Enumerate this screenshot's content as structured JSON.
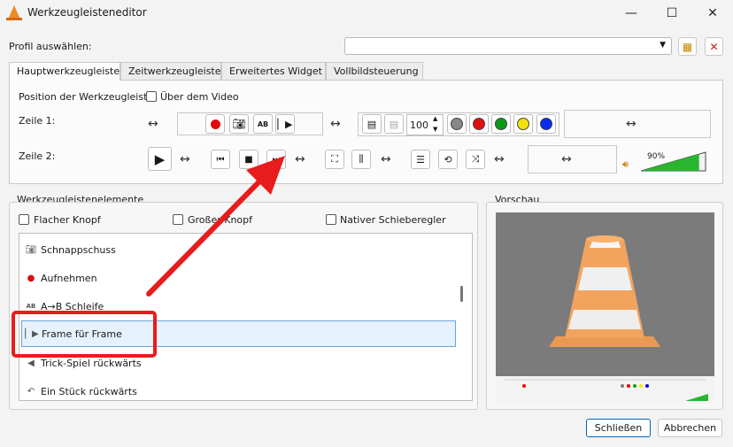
{
  "window": {
    "title": "Werkzeugleisteneditor",
    "minimize": "—",
    "maximize": "☐",
    "close": "✕"
  },
  "profile": {
    "label": "Profil auswählen:",
    "value": "",
    "arrow": "▼"
  },
  "tabs": [
    "Hauptwerkzeugleiste",
    "Zeitwerkzeugleiste",
    "Erweitertes Widget",
    "Vollbildsteuerung"
  ],
  "position": {
    "label": "Position der Werkzeugleiste:",
    "checkbox_label": "Über dem Video"
  },
  "rows": {
    "row1_label": "Zeile 1:",
    "row2_label": "Zeile 2:"
  },
  "spacer_glyph": "↔",
  "spin": {
    "value": "100",
    "up": "▲",
    "down": "▼"
  },
  "volume": {
    "percent": "90%",
    "level": 0.9
  },
  "elements": {
    "group_title": "Werkzeugleistenelemente",
    "flat_button": "Flacher Knopf",
    "big_button": "Großer Knopf",
    "native_slider": "Nativer Schieberegler",
    "items": [
      {
        "label": "Schnappschuss",
        "icon": "camera-icon"
      },
      {
        "label": "Aufnehmen",
        "icon": "record-icon"
      },
      {
        "label": "A→B Schleife",
        "icon": "ab-loop-icon"
      },
      {
        "label": "Frame für Frame",
        "icon": "frame-step-icon"
      },
      {
        "label": "Trick-Spiel rückwärts",
        "icon": "trickplay-back-icon"
      },
      {
        "label": "Ein Stück rückwärts",
        "icon": "jump-back-icon"
      }
    ]
  },
  "preview": {
    "title": "Vorschau"
  },
  "buttons": {
    "close": "Schließen",
    "cancel": "Abbrechen"
  },
  "colors": {
    "accent": "#0067c0",
    "highlight_red": "#e81c1c",
    "cone_orange": "#f08a24",
    "volume_green": "#29b530"
  }
}
